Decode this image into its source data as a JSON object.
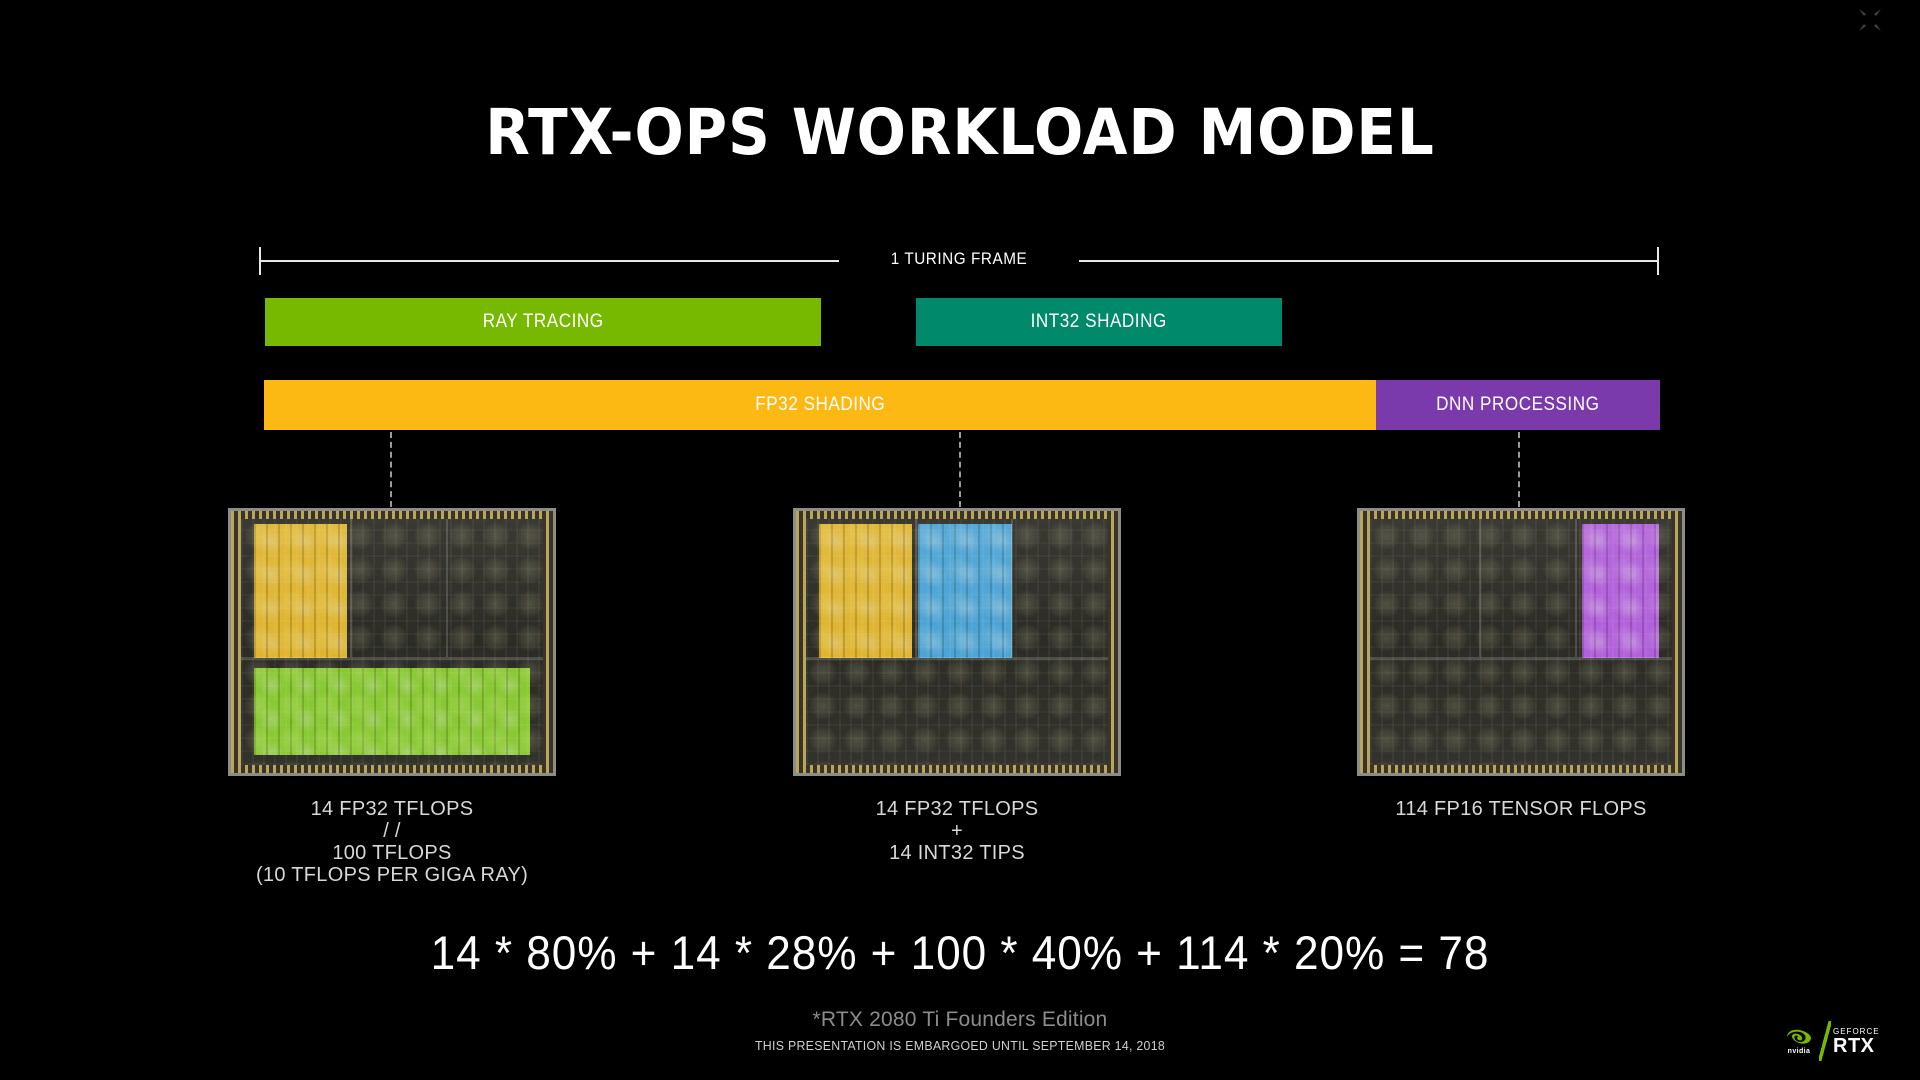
{
  "slide": {
    "title": "RTX-OPS WORKLOAD MODEL",
    "background_color": "#000000"
  },
  "window_controls": {
    "exit_fullscreen_icon": "exit-fullscreen-icon"
  },
  "frame_bracket": {
    "label": "1 TURING FRAME"
  },
  "workload_bars": [
    {
      "id": "ray-tracing",
      "label": "RAY TRACING",
      "color": "#76b900",
      "row": 1
    },
    {
      "id": "int32-shading",
      "label": "INT32 SHADING",
      "color": "#00896b",
      "row": 1
    },
    {
      "id": "fp32-shading",
      "label": "FP32 SHADING",
      "color": "#fdb913",
      "row": 2
    },
    {
      "id": "dnn-processing",
      "label": "DNN PROCESSING",
      "color": "#7b3aab",
      "row": 2
    }
  ],
  "dies": [
    {
      "id": "die-rt",
      "highlight_colors": [
        "#f5b800",
        "#76d400"
      ],
      "caption_lines": [
        "14 FP32 TFLOPS",
        "/ /",
        "100 TFLOPS",
        "(10 TFLOPS PER GIGA RAY)"
      ]
    },
    {
      "id": "die-shading",
      "highlight_colors": [
        "#f5b800",
        "#1f9fe8"
      ],
      "caption_lines": [
        "14 FP32 TFLOPS",
        "+",
        "14 INT32 TIPS"
      ]
    },
    {
      "id": "die-tensor",
      "highlight_colors": [
        "#b23cf0"
      ],
      "caption_lines": [
        "114 FP16 TENSOR FLOPS"
      ]
    }
  ],
  "equation": {
    "text": "14 * 80% + 14 * 28% + 100 * 40% + 114 * 20% = 78"
  },
  "footnotes": {
    "line1": "*RTX 2080 Ti Founders Edition",
    "line2": "THIS PRESENTATION IS EMBARGOED UNTIL SEPTEMBER 14, 2018"
  },
  "logo": {
    "nvidia_wordmark": "nvidia",
    "geforce": "GEFORCE",
    "rtx": "RTX"
  },
  "chart_data": {
    "type": "bar",
    "title": "RTX-OPS WORKLOAD MODEL",
    "subtitle": "1 TURING FRAME",
    "orientation": "horizontal-timeline",
    "frame_total_percent": 100,
    "categories": [
      "RAY TRACING",
      "INT32 SHADING",
      "FP32 SHADING",
      "DNN PROCESSING"
    ],
    "values": [
      80,
      28,
      40,
      20
    ],
    "value_unit": "% of frame time",
    "colors": [
      "#76b900",
      "#00896b",
      "#fdb913",
      "#7b3aab"
    ],
    "throughput": [
      {
        "name": "FP32",
        "value": 14,
        "unit": "TFLOPS"
      },
      {
        "name": "INT32",
        "value": 14,
        "unit": "TIPS"
      },
      {
        "name": "RAY TRACING",
        "value": 100,
        "unit": "TFLOPS"
      },
      {
        "name": "FP16 TENSOR",
        "value": 114,
        "unit": "FLOPS"
      }
    ],
    "formula": "14 * 80% + 14 * 28% + 100 * 40% + 114 * 20% = 78",
    "result": 78,
    "xlabel": "",
    "ylabel": "",
    "grid": false,
    "legend": "none"
  }
}
